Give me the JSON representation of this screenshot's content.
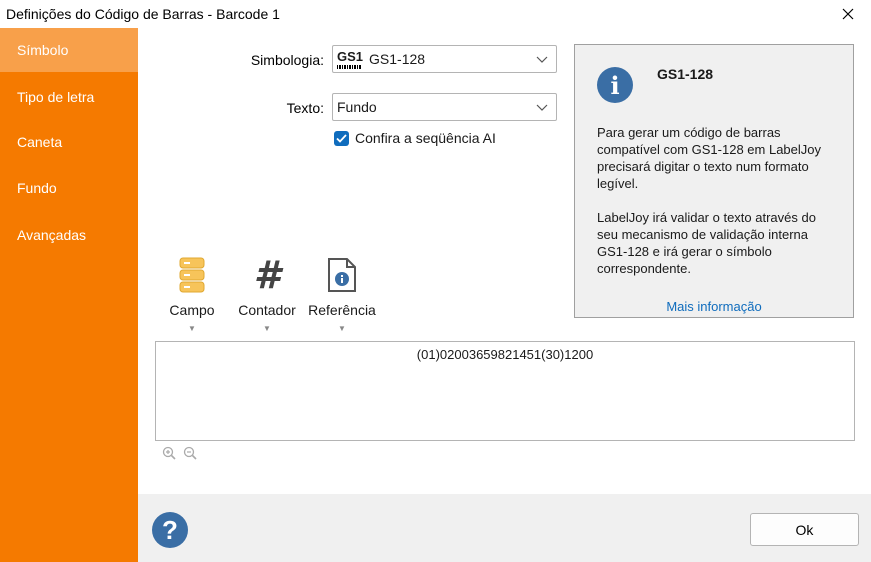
{
  "window": {
    "title": "Definições do Código de Barras - Barcode 1"
  },
  "sidebar": {
    "items": [
      {
        "label": "Símbolo",
        "active": true
      },
      {
        "label": "Tipo de letra"
      },
      {
        "label": "Caneta"
      },
      {
        "label": "Fundo"
      },
      {
        "label": "Avançadas"
      }
    ]
  },
  "form": {
    "symbology_label": "Simbologia:",
    "symbology_logo": "GS1",
    "symbology_value": "GS1-128",
    "text_label": "Texto:",
    "text_value": "Fundo",
    "confirm_label": "Confira a seqüência AI",
    "confirm_checked": true
  },
  "info": {
    "title": "GS1-128",
    "body": "Para gerar um  código de barras compatível com GS1-128  em LabelJoy  precisará digitar o texto num formato legível.\n\nLabelJoy irá validar o texto através do seu mecanismo de validação interna GS1-128 e irá gerar o símbolo correspondente.",
    "link": "Mais informação"
  },
  "tools": [
    {
      "label": "Campo",
      "icon": "database-icon"
    },
    {
      "label": "Contador",
      "icon": "hash-icon"
    },
    {
      "label": "Referência",
      "icon": "info-document-icon"
    }
  ],
  "barcode_text": "(01)02003659821451(30)1200",
  "footer": {
    "ok_label": "Ok"
  },
  "colors": {
    "sidebar": "#f57a00",
    "sidebar_active": "#f8a04a",
    "accent": "#0f6cbd",
    "info_icon": "#3a6ea5"
  }
}
